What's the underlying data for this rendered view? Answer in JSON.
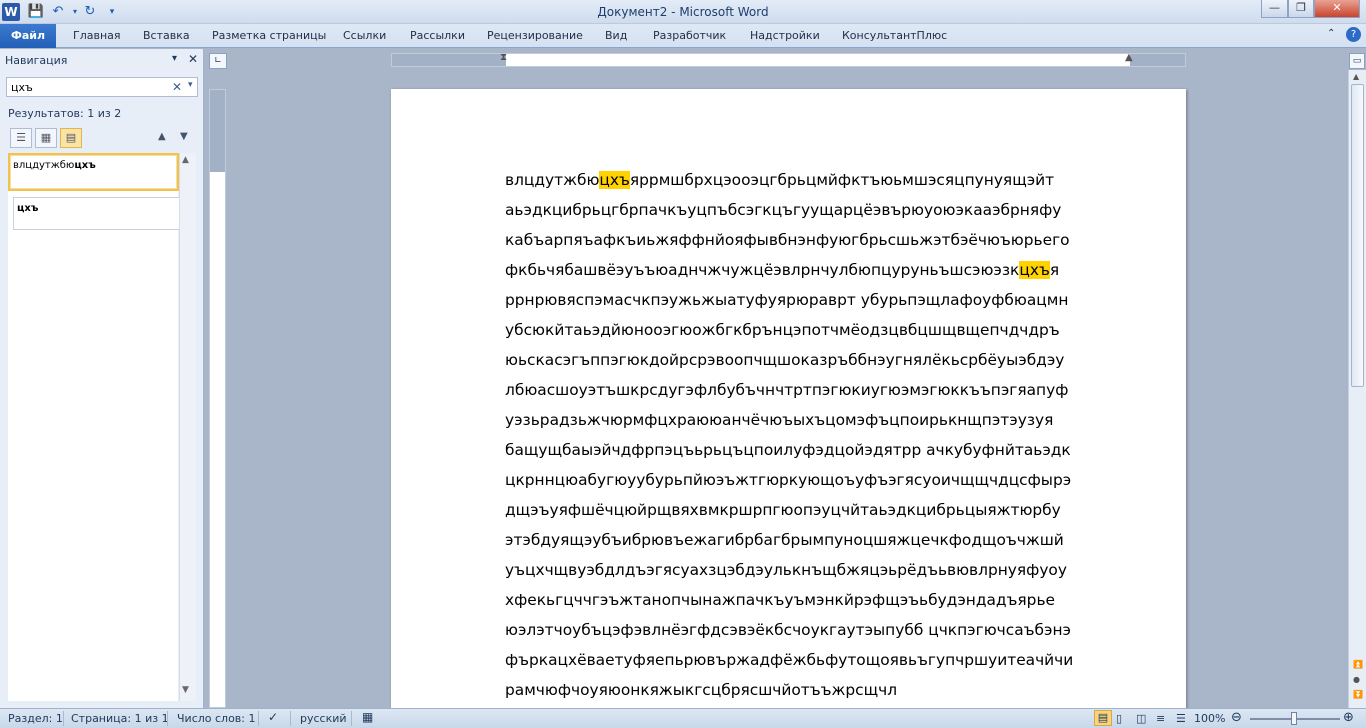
{
  "window": {
    "title": "Документ2 - Microsoft Word",
    "app_icon": "word-icon",
    "controls": {
      "minimize": "—",
      "maximize": "❐",
      "close": "✕"
    }
  },
  "quick_access": {
    "save": "save-icon",
    "undo": "undo-icon",
    "redo": "redo-icon"
  },
  "ribbon": {
    "file_tab": "Файл",
    "tabs": [
      "Главная",
      "Вставка",
      "Разметка страницы",
      "Ссылки",
      "Рассылки",
      "Рецензирование",
      "Вид",
      "Разработчик",
      "Надстройки",
      "КонсультантПлюс"
    ]
  },
  "navigation": {
    "title": "Навигация",
    "search_value": "цхъ",
    "results_text": "Результатов: 1 из 2",
    "results": [
      {
        "prefix": "влцдутжбю",
        "match": "цхъ",
        "selected": true
      },
      {
        "prefix": "",
        "match": "цхъ",
        "selected": false
      }
    ]
  },
  "document": {
    "highlight_color": "#ffd200",
    "lines": [
      {
        "before": "влцдутжбю",
        "match": "цхъ",
        "after": "яррмшбрхцэооэцгбрьцмйфктъюьмшэсяцпунуящэйт"
      },
      {
        "before": "аьэдкцибрьцгбрпачкъуцпъбсэгкцъгуущарцёэвърюуоюэкааэбрняфу",
        "match": "",
        "after": ""
      },
      {
        "before": "кабъарпяъафкъиьжяффнйояфывбнэнфуюгбрьсшьжэтбэёчюъюрьего",
        "match": "",
        "after": ""
      },
      {
        "before": "фкбьчябашвёэуъъюаднчжчужцёэвлрнчулбюпцуруньъшсэюэзк",
        "match": "цхъ",
        "after": "я"
      },
      {
        "before": "ррнрювяспэмасчкпэужьжыатуфуярюраврт убурьпэщлафоуфбюацмн",
        "match": "",
        "after": ""
      },
      {
        "before": "убсюкйтаьэдйюноoэгюожбгкбрънцэпотчмёодзцвбцшщвщепчдчдръ",
        "match": "",
        "after": ""
      },
      {
        "before": "юьскасэгъппэгюкдойрсрэвоопчщшоказръббнэугнялёкьсрбёуыэбдэу",
        "match": "",
        "after": ""
      },
      {
        "before": "лбюасшоуэтъшкрсдугэфлбубъчнчтртпэгюкиугюэмэгюккъъпэгяапуф",
        "match": "",
        "after": ""
      },
      {
        "before": "уэзьрадзьжчюрмфцхраююанчёчюъыхъцомэфъцпоирькнщпэтэузуя",
        "match": "",
        "after": ""
      },
      {
        "before": "бащущбаыэйчдфрпэцъьрьцъцпоилуфэдцойэдятрр ачкубуфнйтаьэдк",
        "match": "",
        "after": ""
      },
      {
        "before": "цкрннцюабугюуубурьпйюэъжтгюркующоъуфъэгясуоичщщчдцсфырэ",
        "match": "",
        "after": ""
      },
      {
        "before": "дщэъуяфшёчцюйрщвяхвмкршрпгюопэуцчйтаьэдкцибрьцыяжтюрбу",
        "match": "",
        "after": ""
      },
      {
        "before": "этэбдуящэубъибрювъежагибрбагбрымпуноцшяжцечкфодщоъчжшй",
        "match": "",
        "after": ""
      },
      {
        "before": "уъцхчщвуэбдлдъэгясуахзцэбдэулькнъщбжяцэьрёдъьвювлрнуяфуоу",
        "match": "",
        "after": ""
      },
      {
        "before": "хфекьгцччгэъжтанопчынажпачкъуъмэнкйрэфщэъьбудэндадъярье",
        "match": "",
        "after": ""
      },
      {
        "before": "юэлэтчоубъцэфэвлнёэгфдсэвэёкбсчоукгаутэыпубб цчкпэгючсаъбэнэ",
        "match": "",
        "after": ""
      },
      {
        "before": "фъркацхёваетуфяепьрювържадфёжбьфутощоявьъгупчршуитеачйчи",
        "match": "",
        "after": ""
      },
      {
        "before": "рамчюфчоуяюонкяжыкгсцбрясшчйотъъжрсщчл",
        "match": "",
        "after": ""
      }
    ]
  },
  "status_bar": {
    "section": "Раздел: 1",
    "page": "Страница: 1 из 1",
    "words": "Число слов: 1",
    "language": "русский",
    "zoom": "100%",
    "zoom_level_percent": 100
  }
}
